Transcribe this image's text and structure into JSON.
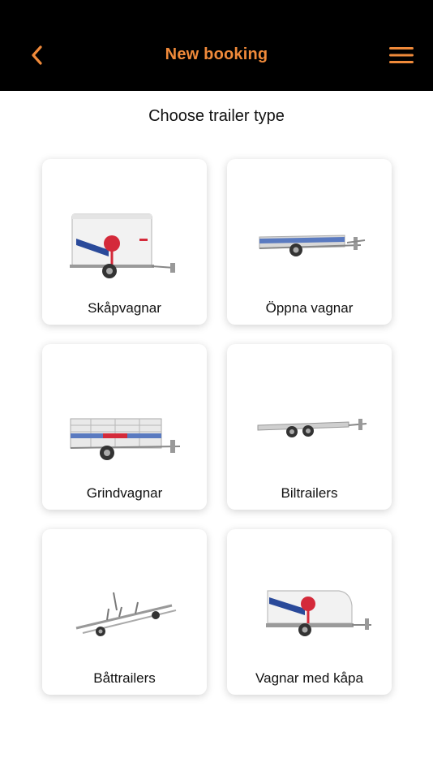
{
  "header": {
    "title": "New booking",
    "accent_color": "#f08a3a",
    "back_icon": "chevron-left-icon",
    "menu_icon": "hamburger-menu-icon"
  },
  "main": {
    "subtitle": "Choose trailer type",
    "options": [
      {
        "label": "Skåpvagnar",
        "image": "box-trailer-image"
      },
      {
        "label": "Öppna vagnar",
        "image": "open-trailer-image"
      },
      {
        "label": "Grindvagnar",
        "image": "gate-trailer-image"
      },
      {
        "label": "Biltrailers",
        "image": "car-trailer-image"
      },
      {
        "label": "Båttrailers",
        "image": "boat-trailer-image"
      },
      {
        "label": "Vagnar med kåpa",
        "image": "covered-trailer-image"
      }
    ]
  }
}
